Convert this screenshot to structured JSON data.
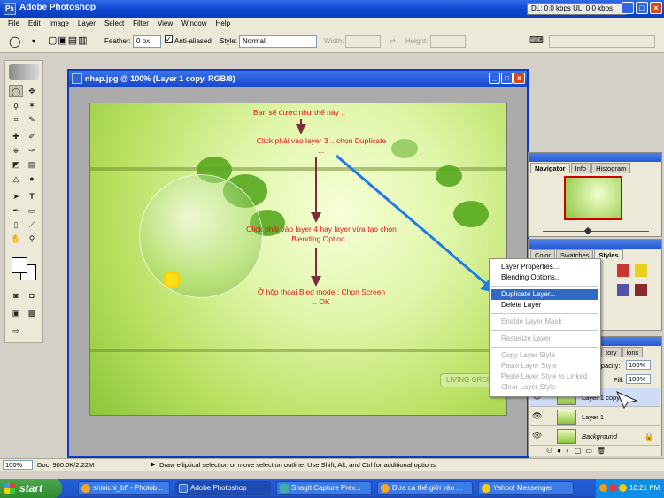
{
  "app": {
    "title": "Adobe Photoshop",
    "netstat": "DL: 0.0 kbps  UL: 0.0 kbps"
  },
  "menu": [
    "File",
    "Edit",
    "Image",
    "Layer",
    "Select",
    "Filter",
    "View",
    "Window",
    "Help"
  ],
  "options": {
    "feather_label": "Feather:",
    "feather_value": "0 px",
    "antialiased_label": "Anti-aliased",
    "style_label": "Style:",
    "style_value": "Normal",
    "width_label": "Width:",
    "height_label": "Height:"
  },
  "document": {
    "title": "nhap.jpg @ 100% (Layer 1 copy, RGB/8)",
    "living_text": "LIVING GREE",
    "notes": [
      "Bạn sẽ được như thế này ..",
      "Click phải vào layer 3 .. chọn Duplicate ...",
      "Click phải vào layer 4 hay layer vừa tạo chọn Blending Option ..",
      "Ở hộp thoại Bled mode  : Chọn Screen .. OK"
    ]
  },
  "status": {
    "zoom": "100%",
    "doc": "Doc: 900.0K/2.22M",
    "hint": "Draw elliptical selection or move selection outline.  Use Shift, Alt, and Ctrl for additional options."
  },
  "navigator_panel": {
    "tabs": [
      "Navigator",
      "Info",
      "Histogram"
    ]
  },
  "color_panel": {
    "tabs": [
      "Color",
      "Swatches",
      "Styles"
    ]
  },
  "layers_panel": {
    "tabs_partial": [
      "tory",
      "ions"
    ],
    "opacity_label": "Opacity:",
    "opacity_value": "100%",
    "fill_label": "Fill:",
    "fill_value": "100%",
    "layers": [
      "Layer 1 copy",
      "Layer 1",
      "Background"
    ]
  },
  "context_menu": {
    "items": [
      {
        "label": "Layer Properties...",
        "state": "enabled"
      },
      {
        "label": "Blending Options...",
        "state": "enabled"
      },
      {
        "label": "Duplicate Layer...",
        "state": "selected"
      },
      {
        "label": "Delete Layer",
        "state": "enabled"
      },
      {
        "label": "Enable Layer Mask",
        "state": "disabled"
      },
      {
        "label": "Rasterize Layer",
        "state": "disabled"
      },
      {
        "label": "Copy Layer Style",
        "state": "disabled"
      },
      {
        "label": "Paste Layer Style",
        "state": "disabled"
      },
      {
        "label": "Paste Layer Style to Linked",
        "state": "disabled"
      },
      {
        "label": "Clear Layer Style",
        "state": "disabled"
      }
    ]
  },
  "taskbar": {
    "start": "start",
    "tasks": [
      "shinichi_bff - Photob...",
      "Adobe Photoshop",
      "SnagIt Capture Prev...",
      "Đưa cả thế giới vào ...",
      "Yahoo! Messenger"
    ],
    "clock": "10:21 PM"
  },
  "colors": {
    "note_red": "#e2141a",
    "arrow_blue": "#1e7be8",
    "arrow_maroon": "#7a2e3a",
    "selection_blue": "#316ac5"
  }
}
